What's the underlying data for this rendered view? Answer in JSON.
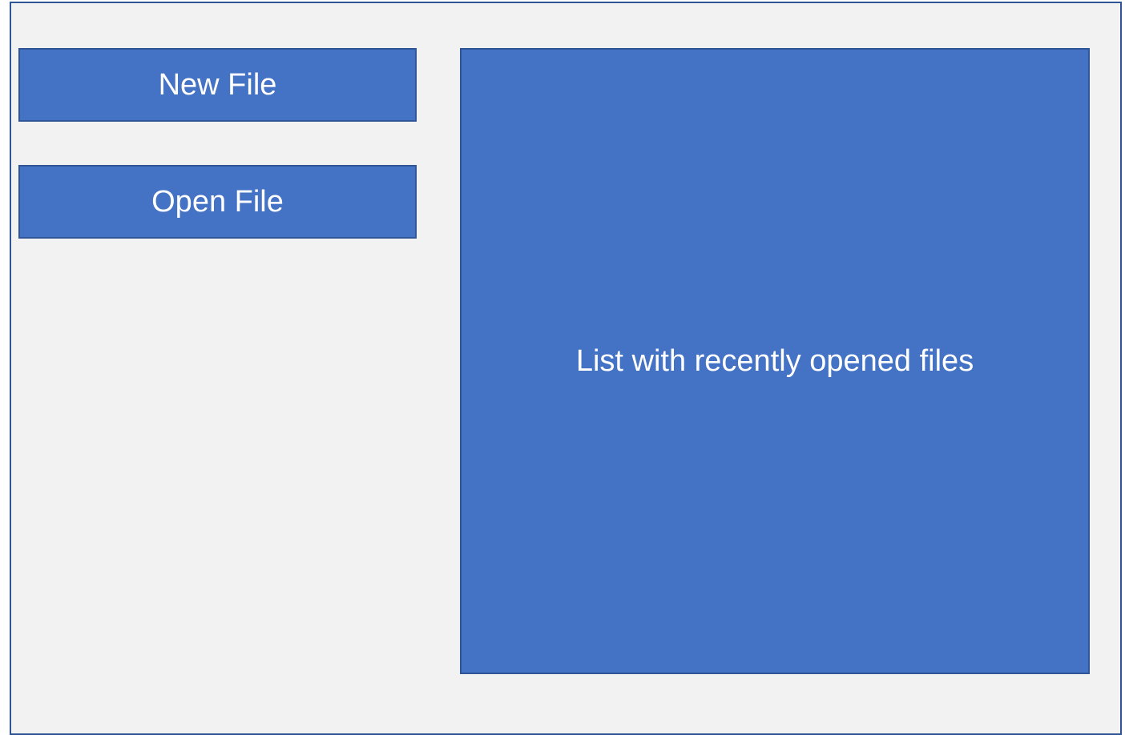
{
  "colors": {
    "background": "#f2f2f2",
    "accent": "#4472c4",
    "border": "#2f5597",
    "text": "#ffffff"
  },
  "actions": {
    "new_file_label": "New File",
    "open_file_label": "Open File"
  },
  "recent_files": {
    "placeholder_label": "List with recently opened files"
  }
}
